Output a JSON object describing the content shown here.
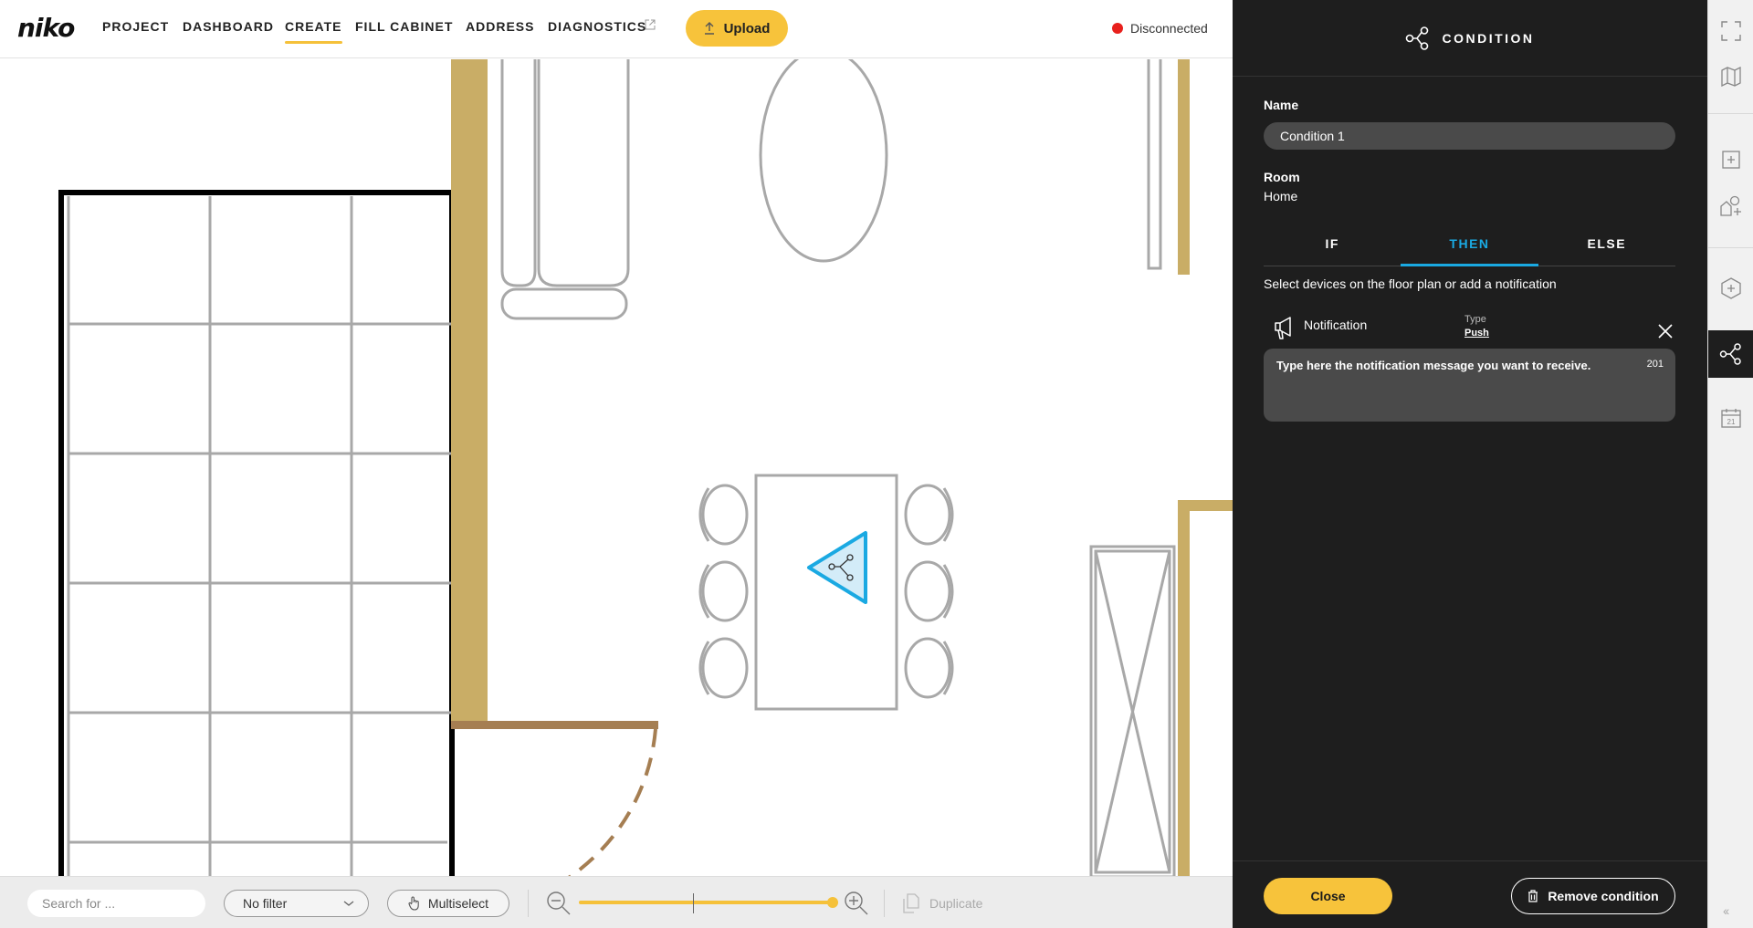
{
  "app": {
    "logo": "niko"
  },
  "nav": {
    "items": [
      {
        "label": "PROJECT"
      },
      {
        "label": "DASHBOARD"
      },
      {
        "label": "CREATE"
      },
      {
        "label": "FILL CABINET"
      },
      {
        "label": "ADDRESS"
      },
      {
        "label": "DIAGNOSTICS"
      }
    ],
    "active": "CREATE",
    "upload_label": "Upload",
    "status_label": "Disconnected",
    "status_color": "#e8201c"
  },
  "bottombar": {
    "search_placeholder": "Search for ...",
    "filter_label": "No filter",
    "multiselect_label": "Multiselect",
    "duplicate_label": "Duplicate",
    "zoom_level": 0.98
  },
  "panel": {
    "title": "CONDITION",
    "name_label": "Name",
    "name_value": "Condition 1",
    "room_label": "Room",
    "room_value": "Home",
    "tabs": [
      {
        "label": "IF"
      },
      {
        "label": "THEN"
      },
      {
        "label": "ELSE"
      }
    ],
    "active_tab": "THEN",
    "hint": "Select devices on the floor plan or add a notification",
    "notification": {
      "label": "Notification",
      "type_label": "Type",
      "type_value": "Push",
      "message_placeholder": "Type here the notification message you want to receive.",
      "char_count": "201"
    },
    "close_label": "Close",
    "remove_label": "Remove condition"
  },
  "toolbar": {
    "icons": [
      "expand-icon",
      "map-icon",
      "add-icon",
      "add-shape-icon",
      "add-hexagon-icon",
      "condition-icon",
      "calendar-icon"
    ],
    "calendar_day": "21",
    "collapse_glyph": "‹‹"
  },
  "colors": {
    "accent": "#f7c33b",
    "panel_bg": "#1e1e1e",
    "active_tab": "#1aa9e2",
    "wall": "#c9ad66",
    "door": "#a57e52",
    "furniture": "#a8a8a8"
  }
}
